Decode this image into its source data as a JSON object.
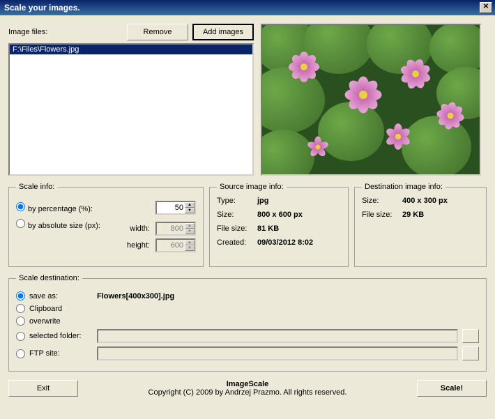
{
  "window": {
    "title": "Scale your images."
  },
  "imageFiles": {
    "label": "Image files:",
    "remove": "Remove",
    "add": "Add images",
    "items": [
      "F:\\Files\\Flowers.jpg"
    ]
  },
  "scaleInfo": {
    "legend": "Scale info:",
    "byPercentLabel": "by percentage (%):",
    "byAbsoluteLabel": "by absolute size (px):",
    "percentValue": "50",
    "widthLabel": "width:",
    "heightLabel": "height:",
    "widthValue": "800",
    "heightValue": "600"
  },
  "sourceInfo": {
    "legend": "Source image info:",
    "typeLabel": "Type:",
    "type": "jpg",
    "sizeLabel": "Size:",
    "size": "800 x 600 px",
    "fileSizeLabel": "File size:",
    "fileSize": "81 KB",
    "createdLabel": "Created:",
    "created": "09/03/2012 8:02"
  },
  "destInfo": {
    "legend": "Destination image info:",
    "sizeLabel": "Size:",
    "size": "400 x 300 px",
    "fileSizeLabel": "File size:",
    "fileSize": "29 KB"
  },
  "scaleDest": {
    "legend": "Scale destination:",
    "saveAsLabel": "save as:",
    "saveAsValue": "Flowers[400x300].jpg",
    "clipboardLabel": "Clipboard",
    "overwriteLabel": "overwrite",
    "selectedFolderLabel": "selected folder:",
    "ftpLabel": "FTP site:"
  },
  "footer": {
    "exit": "Exit",
    "productName": "ImageScale",
    "copyright": "Copyright (C) 2009 by Andrzej Prazmo. All rights reserved.",
    "scale": "Scale!"
  }
}
